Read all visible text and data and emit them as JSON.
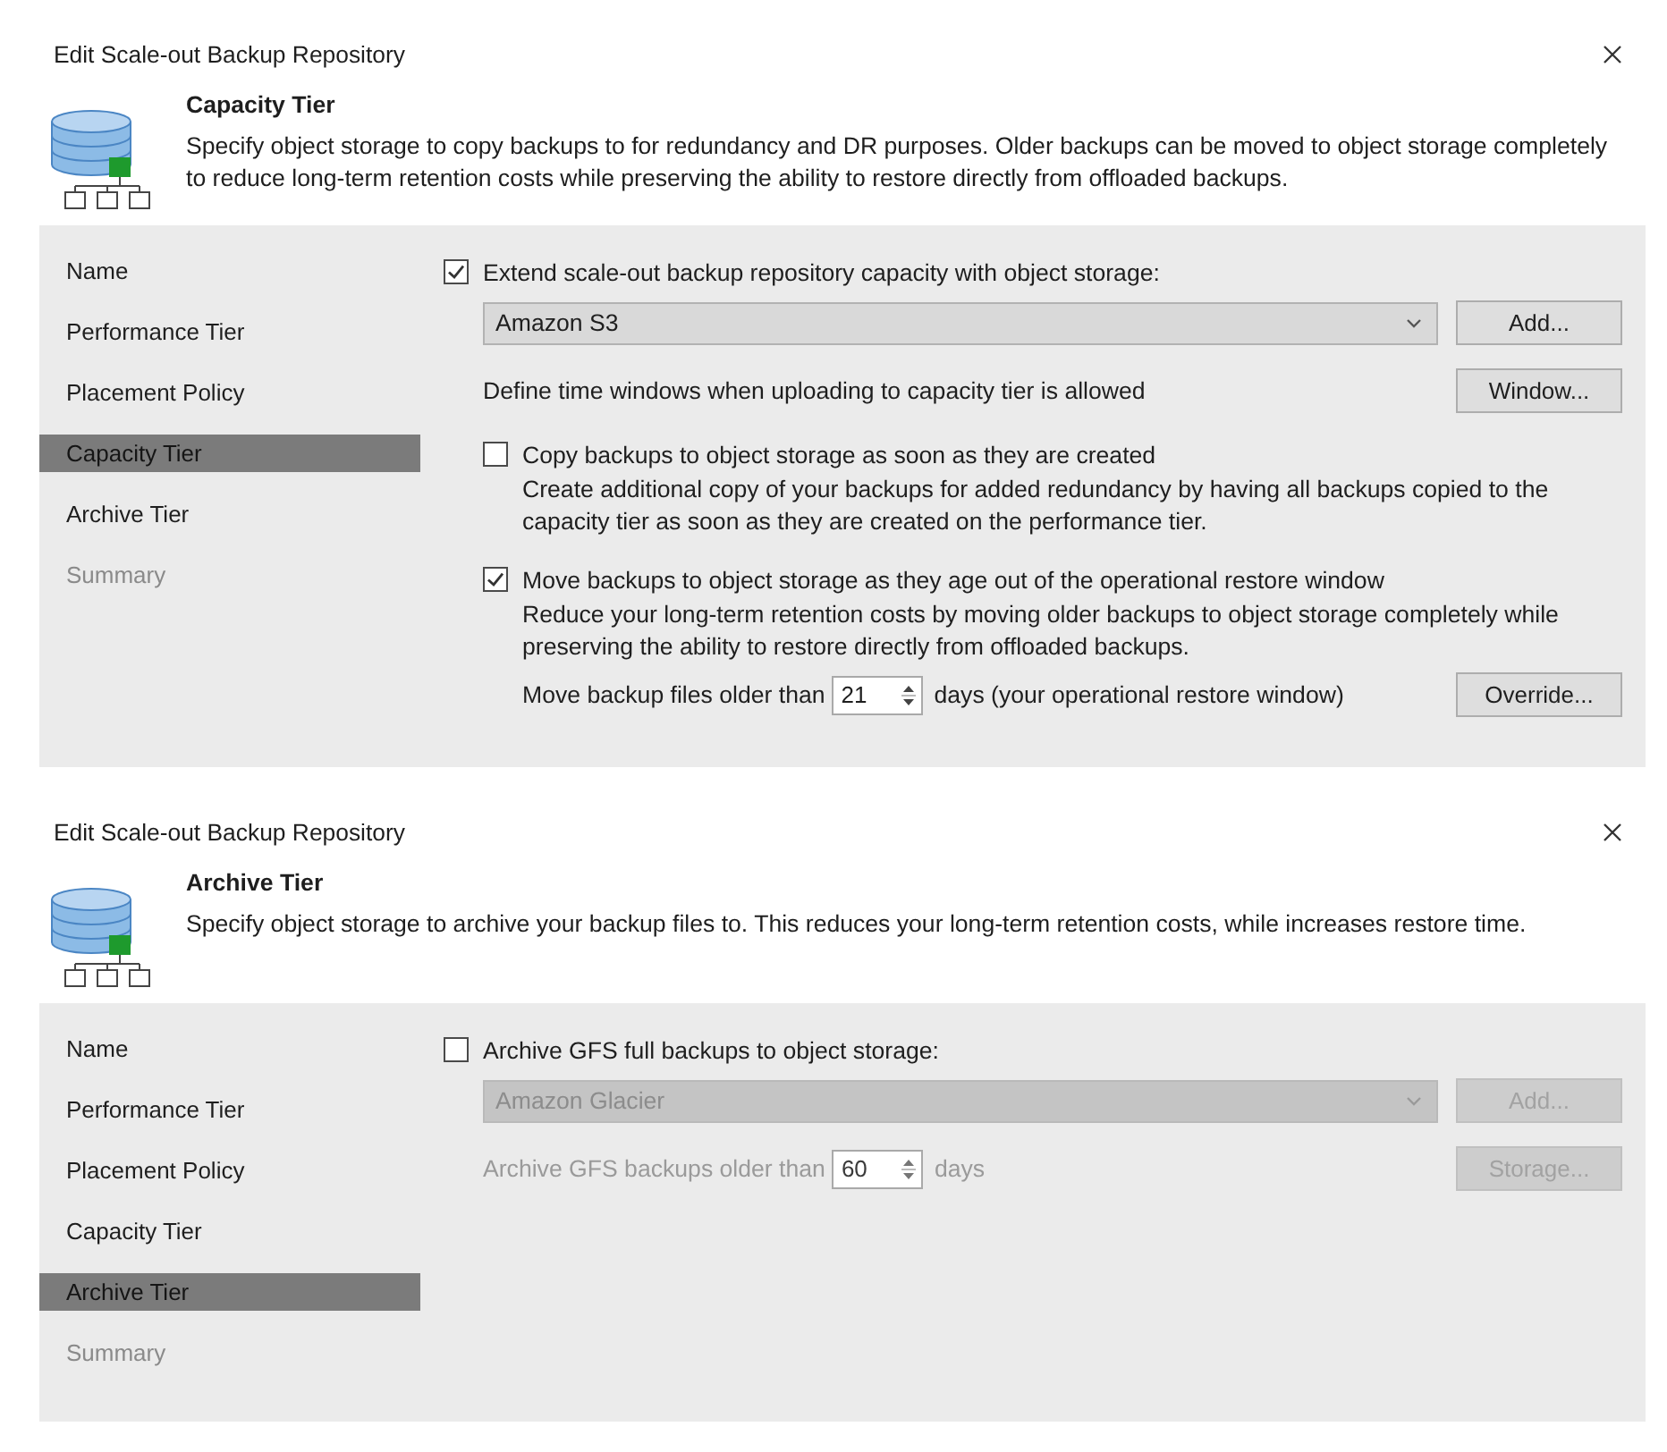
{
  "dialogs": [
    {
      "title": "Edit Scale-out Backup Repository",
      "header": {
        "heading": "Capacity Tier",
        "description": "Specify object storage to copy backups to for redundancy and DR purposes. Older backups can be moved to object storage completely to reduce long-term retention costs while preserving the ability to restore directly from offloaded backups."
      },
      "steps": [
        {
          "label": "Name",
          "selected": false,
          "disabled": false
        },
        {
          "label": "Performance Tier",
          "selected": false,
          "disabled": false
        },
        {
          "label": "Placement Policy",
          "selected": false,
          "disabled": false
        },
        {
          "label": "Capacity Tier",
          "selected": true,
          "disabled": false
        },
        {
          "label": "Archive Tier",
          "selected": false,
          "disabled": false
        },
        {
          "label": "Summary",
          "selected": false,
          "disabled": true
        }
      ],
      "options": [
        {
          "kind": "checkbox",
          "label": "Extend scale-out backup repository capacity with object storage:",
          "checked": true,
          "children": [
            {
              "kind": "select",
              "value": "Amazon S3",
              "disabled": false,
              "button": {
                "label": "Add...",
                "disabled": false
              }
            },
            {
              "kind": "text",
              "text": "Define time windows when uploading to capacity tier is allowed",
              "button": {
                "label": "Window...",
                "disabled": false
              }
            },
            {
              "kind": "checkbox",
              "label": "Copy backups to object storage as soon as they are created",
              "checked": false,
              "description": "Create additional copy of your backups for added redundancy by having all backups copied to the capacity tier as soon as they are created on the performance tier."
            },
            {
              "kind": "checkbox",
              "label": "Move backups to object storage as they age out of the operational restore window",
              "checked": true,
              "description": "Reduce your long-term retention costs by moving older backups to object storage completely while preserving the ability to restore directly from offloaded backups.",
              "children": [
                {
                  "kind": "spinner",
                  "before": "Move backup files older than",
                  "value": "21",
                  "after": "days (your operational restore window)",
                  "disabled": false,
                  "button": {
                    "label": "Override...",
                    "disabled": false
                  }
                }
              ]
            }
          ]
        }
      ]
    },
    {
      "title": "Edit Scale-out Backup Repository",
      "header": {
        "heading": "Archive Tier",
        "description": "Specify object storage to archive your backup files to. This reduces your long-term retention costs, while increases restore time."
      },
      "steps": [
        {
          "label": "Name",
          "selected": false,
          "disabled": false
        },
        {
          "label": "Performance Tier",
          "selected": false,
          "disabled": false
        },
        {
          "label": "Placement Policy",
          "selected": false,
          "disabled": false
        },
        {
          "label": "Capacity Tier",
          "selected": false,
          "disabled": false
        },
        {
          "label": "Archive Tier",
          "selected": true,
          "disabled": false
        },
        {
          "label": "Summary",
          "selected": false,
          "disabled": true
        }
      ],
      "options": [
        {
          "kind": "checkbox",
          "label": "Archive GFS full backups to object storage:",
          "checked": false,
          "children": [
            {
              "kind": "select",
              "value": "Amazon Glacier",
              "disabled": true,
              "button": {
                "label": "Add...",
                "disabled": true
              }
            },
            {
              "kind": "spinner",
              "before": "Archive GFS backups older than",
              "value": "60",
              "after": "days",
              "disabled": true,
              "button": {
                "label": "Storage...",
                "disabled": true
              }
            }
          ]
        }
      ]
    }
  ]
}
